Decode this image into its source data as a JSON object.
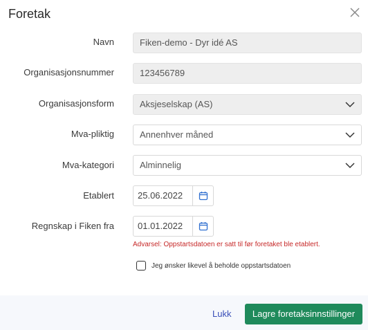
{
  "dialog": {
    "title": "Foretak",
    "close_icon": "close-icon"
  },
  "form": {
    "navn": {
      "label": "Navn",
      "value": "Fiken-demo - Dyr idé AS"
    },
    "orgnr": {
      "label": "Organisasjonsnummer",
      "value": "123456789"
    },
    "orgform": {
      "label": "Organisasjonsform",
      "value": "Aksjeselskap (AS)"
    },
    "mva_pliktig": {
      "label": "Mva-pliktig",
      "value": "Annenhver måned"
    },
    "mva_kategori": {
      "label": "Mva-kategori",
      "value": "Alminnelig"
    },
    "etablert": {
      "label": "Etablert",
      "value": "25.06.2022"
    },
    "regnskap_fra": {
      "label": "Regnskap i Fiken fra",
      "value": "01.01.2022"
    },
    "warning": "Advarsel: Oppstartsdatoen er satt til før foretaket ble etablert.",
    "keep_date_checkbox": {
      "label": "Jeg ønsker likevel å beholde oppstartsdatoen",
      "checked": false
    }
  },
  "footer": {
    "close_label": "Lukk",
    "save_label": "Lagre foretaksinnstillinger"
  },
  "colors": {
    "primary": "#1f8a5b",
    "link": "#3a4fb8",
    "warning": "#c62828",
    "calendar_icon": "#2f6fd0"
  }
}
